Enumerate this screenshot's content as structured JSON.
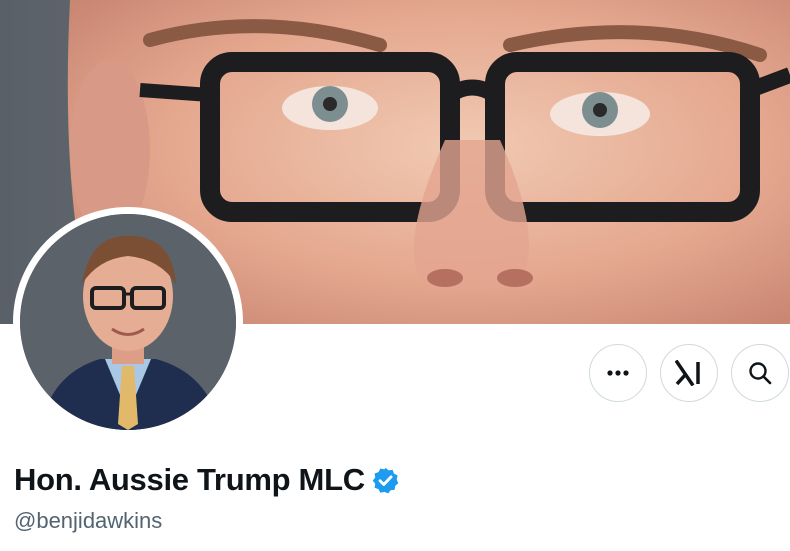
{
  "profile": {
    "display_name": "Hon. Aussie Trump MLC",
    "handle": "@benjidawkins",
    "verified": true
  },
  "actions": [
    {
      "name": "more",
      "icon": "more-icon"
    },
    {
      "name": "grok",
      "icon": "grok-icon"
    },
    {
      "name": "search",
      "icon": "search-icon"
    }
  ],
  "colors": {
    "verified_badge": "#1d9bf0",
    "name_text": "#0f1419",
    "handle_text": "#536471",
    "button_border": "#cfd9de"
  }
}
